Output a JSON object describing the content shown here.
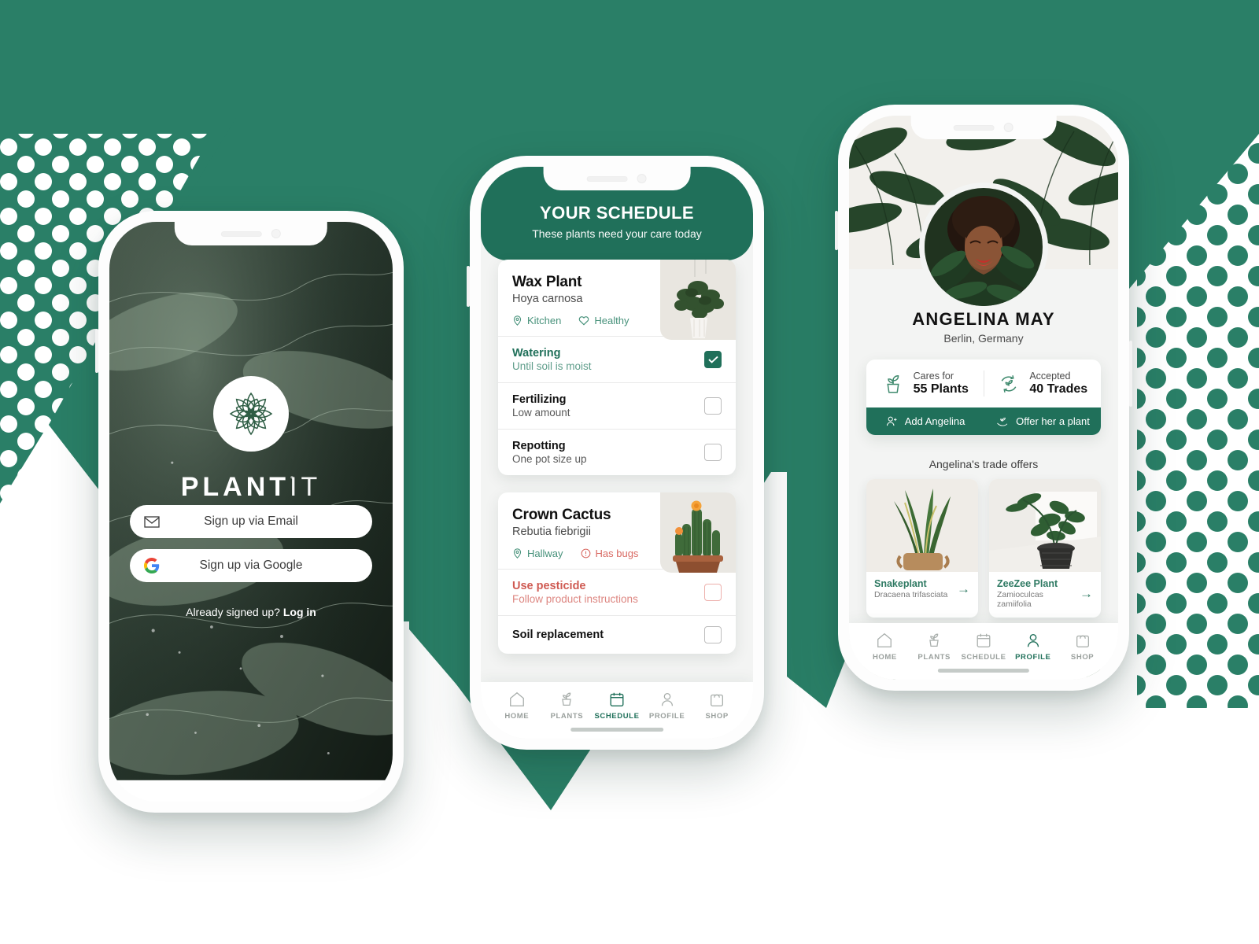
{
  "background": {
    "accent_green": "#2A7F67",
    "deep_green": "#20705A",
    "page_bg": "#FFFFFF",
    "dots_left_color": "#FFFFFF",
    "dots_right_color": "#2A7F67"
  },
  "phone1": {
    "screen_name": "onboarding",
    "logo_icon": "lotus-flower-logo-icon",
    "brand_bold": "PLANT",
    "brand_thin": "IT",
    "buttons": [
      {
        "icon": "envelope-icon",
        "label": "Sign up via Email"
      },
      {
        "icon": "google-g-icon",
        "label": "Sign up via Google"
      }
    ],
    "signin_prompt": "Already signed up?",
    "signin_link": "Log in"
  },
  "phone2": {
    "screen_name": "schedule",
    "header": {
      "title": "YOUR SCHEDULE",
      "subtitle": "These plants need your care today"
    },
    "cards": [
      {
        "name": "Wax Plant",
        "species": "Hoya carnosa",
        "tags": [
          {
            "icon": "location-pin-icon",
            "label": "Kitchen",
            "tone": "green"
          },
          {
            "icon": "heart-icon",
            "label": "Healthy",
            "tone": "green"
          }
        ],
        "tasks": [
          {
            "name": "Watering",
            "desc": "Until soil is moist",
            "checked": true,
            "tone": "green"
          },
          {
            "name": "Fertilizing",
            "desc": "Low amount",
            "checked": false,
            "tone": "dark"
          },
          {
            "name": "Repotting",
            "desc": "One pot size up",
            "checked": false,
            "tone": "dark"
          }
        ]
      },
      {
        "name": "Crown Cactus",
        "species": "Rebutia fiebrigii",
        "tags": [
          {
            "icon": "location-pin-icon",
            "label": "Hallway",
            "tone": "green"
          },
          {
            "icon": "alert-circle-icon",
            "label": "Has bugs",
            "tone": "red"
          }
        ],
        "tasks": [
          {
            "name": "Use pesticide",
            "desc": "Follow product instructions",
            "checked": false,
            "tone": "red"
          },
          {
            "name": "Soil replacement",
            "desc": "",
            "checked": false,
            "tone": "dark"
          }
        ]
      }
    ],
    "tabs": [
      {
        "icon": "home-icon",
        "label": "HOME",
        "active": false
      },
      {
        "icon": "potted-plant-icon",
        "label": "PLANTS",
        "active": false
      },
      {
        "icon": "calendar-icon",
        "label": "SCHEDULE",
        "active": true
      },
      {
        "icon": "person-icon",
        "label": "PROFILE",
        "active": false
      },
      {
        "icon": "shopping-bag-icon",
        "label": "SHOP",
        "active": false
      }
    ]
  },
  "phone3": {
    "screen_name": "profile",
    "avatar": "user-avatar",
    "name": "ANGELINA MAY",
    "location": "Berlin, Germany",
    "stats": [
      {
        "icon": "potted-plant-icon",
        "label": "Cares for",
        "value": "55 Plants"
      },
      {
        "icon": "trade-recycle-icon",
        "label": "Accepted",
        "value": "40 Trades"
      }
    ],
    "actions": [
      {
        "icon": "add-person-icon",
        "label": "Add Angelina"
      },
      {
        "icon": "hand-plant-icon",
        "label": "Offer her a plant"
      }
    ],
    "offers_title": "Angelina's trade offers",
    "offers": [
      {
        "name": "Snakeplant",
        "species": "Dracaena trifasciata",
        "arrow": "→"
      },
      {
        "name": "ZeeZee Plant",
        "species": "Zamioculcas zamiifolia",
        "arrow": "→"
      }
    ],
    "tabs": [
      {
        "icon": "home-icon",
        "label": "HOME",
        "active": false
      },
      {
        "icon": "potted-plant-icon",
        "label": "PLANTS",
        "active": false
      },
      {
        "icon": "calendar-icon",
        "label": "SCHEDULE",
        "active": false
      },
      {
        "icon": "person-icon",
        "label": "PROFILE",
        "active": true
      },
      {
        "icon": "shopping-bag-icon",
        "label": "SHOP",
        "active": false
      }
    ]
  }
}
